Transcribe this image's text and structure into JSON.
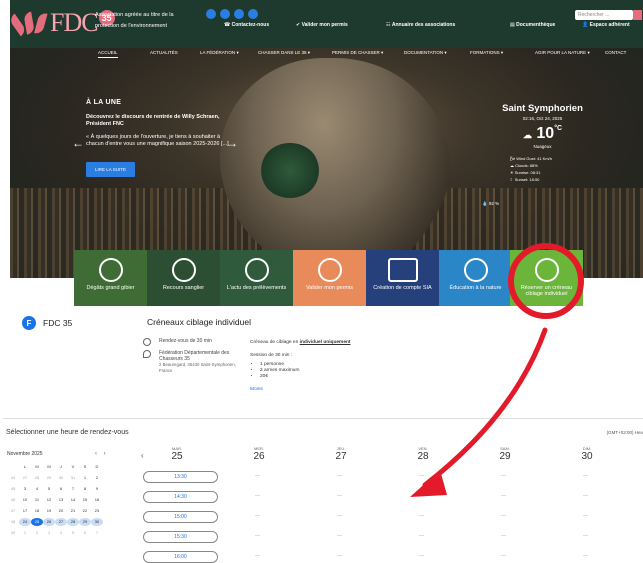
{
  "header": {
    "logo_text": "FDC",
    "logo_badge": "35",
    "assoc_line1": "Association agréée au titre de la",
    "assoc_line2": "protection de l'environnement",
    "links": [
      "Contactez-nous",
      "Valider mon permis",
      "Annuaire des associations",
      "Documenthèque",
      "Espace adhérent"
    ],
    "search_placeholder": "Rechercher ..."
  },
  "nav": [
    "ACCUEIL",
    "ACTUALITÉS",
    "LA FÉDÉRATION",
    "CHASSER DANS LE 35",
    "PERMIS DE CHASSER",
    "DOCUMENTATION",
    "FORMATIONS",
    "AGIR POUR LA NATURE",
    "CONTACT"
  ],
  "hero": {
    "heading": "À LA UNE",
    "news_title": "Découvrez le discours de rentrée de Willy Schraen, Président FNC",
    "news_text": "« À quelques jours de l'ouverture, je tiens à souhaiter à chacun d'entre vous une magnifique saison 2025-2026 [...]",
    "button": "LIRE LA SUITE"
  },
  "weather": {
    "city": "Saint Symphorien",
    "date": "02:16, Oct 24, 2025",
    "temp": "10",
    "unit": "°C",
    "desc": "Nuageux",
    "wind": "Wind Gust: 41 Km/h",
    "clouds": "Clouds: 88%",
    "sunrise": "Sunrise: 08:31",
    "sunset": "Sunset: 18:50",
    "humidity": "92 %"
  },
  "tiles": [
    {
      "label": "Dégâts grand gibier",
      "color": "#3f6b34"
    },
    {
      "label": "Recours sanglier",
      "color": "#2c4f33"
    },
    {
      "label": "L'actu des prélèvements",
      "color": "#2f5a3c"
    },
    {
      "label": "Valider mon permis",
      "color": "#e98a5a"
    },
    {
      "label": "Création de compte SIA",
      "color": "#25407a"
    },
    {
      "label": "Éducation à la nature",
      "color": "#2a86c7"
    },
    {
      "label": "Réserver un créneau ciblage individuel",
      "color": "#6bb53b"
    }
  ],
  "booking": {
    "org_initial": "F",
    "org_name": "FDC 35",
    "title": "Créneaux ciblage individuel",
    "duration": "Rendez-vous de 30 min",
    "place_name": "Fédération Départementale des Chasseurs 35",
    "place_addr": "2 Beauregard, 35430 Saint-Symphorien, France",
    "desc_line1_a": "Créneau de ciblage en ",
    "desc_line1_b": "individuel uniquement",
    "desc_line2": "Session de 30 min :",
    "bullets": [
      "1 personne",
      "2 armes maximum",
      "20€"
    ],
    "more": "Moins"
  },
  "calendar": {
    "heading": "Sélectionner une heure de rendez-vous",
    "timezone": "(GMT+02:00) Heu",
    "month": "Novembre 2025",
    "weekday_initials": [
      "L",
      "M",
      "M",
      "J",
      "V",
      "S",
      "D"
    ],
    "weeks": [
      [
        "27",
        "28",
        "29",
        "30",
        "31",
        "1",
        "2"
      ],
      [
        "3",
        "4",
        "5",
        "6",
        "7",
        "8",
        "9"
      ],
      [
        "10",
        "11",
        "12",
        "13",
        "14",
        "15",
        "16"
      ],
      [
        "17",
        "18",
        "19",
        "20",
        "21",
        "22",
        "23"
      ],
      [
        "24",
        "25",
        "26",
        "27",
        "28",
        "29",
        "30"
      ],
      [
        "1",
        "2",
        "3",
        "4",
        "5",
        "6",
        "7"
      ]
    ],
    "week_numbers": [
      "44",
      "45",
      "46",
      "47",
      "48",
      "49"
    ],
    "days": [
      {
        "w": "MAR.",
        "n": "25"
      },
      {
        "w": "MER.",
        "n": "26"
      },
      {
        "w": "JEU.",
        "n": "27"
      },
      {
        "w": "VEN.",
        "n": "28"
      },
      {
        "w": "SAM.",
        "n": "29"
      },
      {
        "w": "DIM.",
        "n": "30"
      }
    ],
    "slots": [
      "13:30",
      "14:30",
      "15:00",
      "15:30",
      "16:00"
    ],
    "empty": "—"
  }
}
